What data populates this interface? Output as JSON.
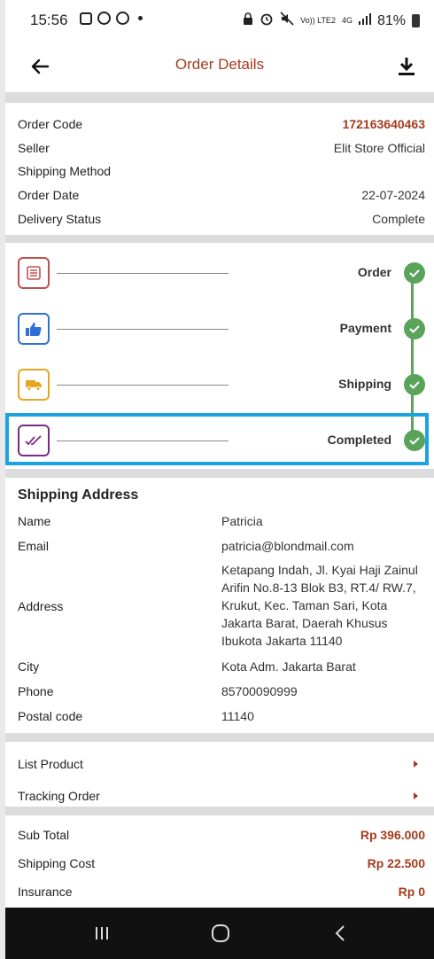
{
  "status_bar": {
    "time": "15:56",
    "battery": "81%",
    "network": "4G",
    "volte": "Vo)) LTE2"
  },
  "app_bar": {
    "title": "Order Details",
    "back_icon": "arrow-left-icon",
    "download_icon": "download-icon"
  },
  "order": {
    "code_label": "Order Code",
    "code_value": "172163640463",
    "seller_label": "Seller",
    "seller_value": "Elit Store Official",
    "shipping_method_label": "Shipping Method",
    "order_date_label": "Order Date",
    "order_date_value": "22-07-2024",
    "delivery_status_label": "Delivery Status",
    "delivery_status_value": "Complete"
  },
  "steps": [
    {
      "label": "Order",
      "icon": "receipt-icon",
      "color": "#c0504d"
    },
    {
      "label": "Payment",
      "icon": "thumbs-up-icon",
      "color": "#2f6fd6"
    },
    {
      "label": "Shipping",
      "icon": "truck-icon",
      "color": "#e6a623"
    },
    {
      "label": "Completed",
      "icon": "double-check-icon",
      "color": "#7b2a8c"
    }
  ],
  "shipping_address": {
    "title": "Shipping Address",
    "name_label": "Name",
    "name_value": "Patricia",
    "email_label": "Email",
    "email_value": "patricia@blondmail.com",
    "address_label": "Address",
    "address_value": "Ketapang Indah, Jl. Kyai Haji Zainul Arifin No.8-13 Blok B3, RT.4/ RW.7, Krukut, Kec. Taman Sari, Kota Jakarta Barat, Daerah Khusus Ibukota Jakarta 11140",
    "city_label": "City",
    "city_value": "Kota Adm. Jakarta Barat",
    "phone_label": "Phone",
    "phone_value": "85700090999",
    "postal_label": "Postal code",
    "postal_value": "11140"
  },
  "links": {
    "list_product": "List Product",
    "tracking_order": "Tracking Order"
  },
  "totals": {
    "subtotal_label": "Sub Total",
    "subtotal_value": "Rp 396.000",
    "shipping_label": "Shipping Cost",
    "shipping_value": "Rp 22.500",
    "insurance_label": "Insurance",
    "insurance_value": "Rp 0"
  },
  "colors": {
    "accent": "#a53b1e",
    "success": "#5aa35a",
    "highlight": "#1aa3e0"
  }
}
